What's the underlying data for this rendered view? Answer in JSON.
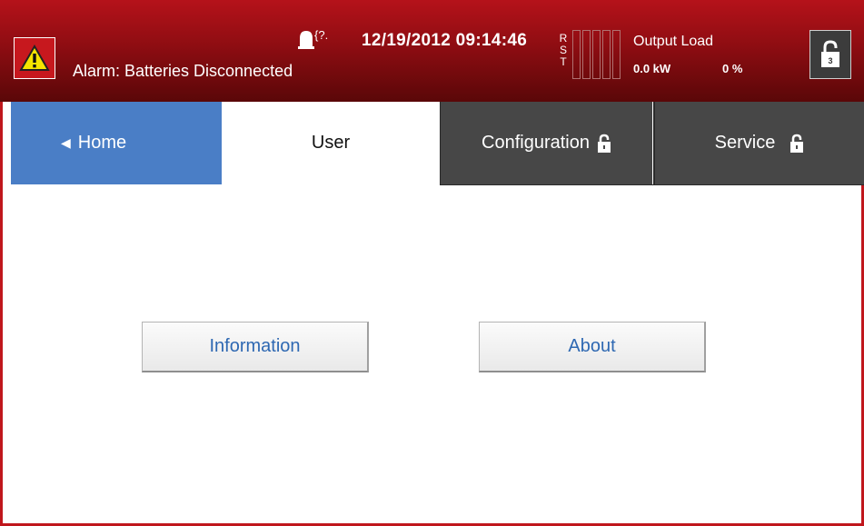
{
  "header": {
    "alarm_text": "Alarm: Batteries Disconnected",
    "datetime": "12/19/2012 09:14:46",
    "phase_letters": [
      "R",
      "S",
      "T"
    ],
    "output_load_label": "Output Load",
    "output_kw": "0.0 kW",
    "output_pct": "0 %",
    "alarm_icon": "warning-icon",
    "status_icon": "alarm-bell-question-icon",
    "lock_icon": "unlock-icon",
    "accent_color": "#b5121a"
  },
  "tabs": {
    "home": "Home",
    "user": "User",
    "configuration": "Configuration",
    "service": "Service"
  },
  "main": {
    "information_label": "Information",
    "about_label": "About"
  }
}
